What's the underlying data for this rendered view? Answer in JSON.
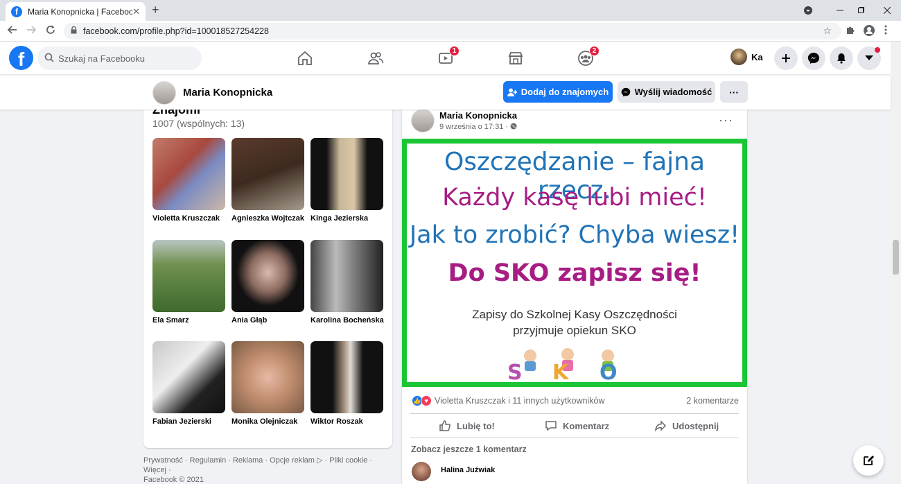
{
  "browser": {
    "tab_title": "Maria Konopnicka | Facebook",
    "tab_close": "✕",
    "new_tab": "+",
    "url": "facebook.com/profile.php?id=100018527254228"
  },
  "fb": {
    "logo": "f",
    "search_placeholder": "Szukaj na Facebooku",
    "watch_badge": "1",
    "groups_badge": "2",
    "profile_short": "Ka"
  },
  "profile": {
    "name": "Maria Konopnicka",
    "add_friend": "Dodaj do znajomych",
    "send_message": "Wyślij wiadomość",
    "more": "···"
  },
  "friends": {
    "title": "Znajomi",
    "count": "1007 (wspólnych: 13)",
    "items": [
      {
        "name": "Violetta Kruszczak"
      },
      {
        "name": "Agnieszka Wojtczak"
      },
      {
        "name": "Kinga Jezierska"
      },
      {
        "name": "Ela Smarz"
      },
      {
        "name": "Ania Głąb"
      },
      {
        "name": "Karolina Bocheńska"
      },
      {
        "name": "Fabian Jezierski"
      },
      {
        "name": "Monika Olejniczak"
      },
      {
        "name": "Wiktor Roszak"
      }
    ]
  },
  "footer": {
    "links": "Prywatność · Regulamin · Reklama · Opcje reklam ▷ · Pliki cookie · Więcej ·",
    "copyright": "Facebook © 2021"
  },
  "post": {
    "author": "Maria Konopnicka",
    "date": "9 września o 17:31 · ",
    "dots": "···",
    "image": {
      "line1": "Oszczędzanie – fajna rzecz.",
      "line2": "Każdy kasę lubi mieć!",
      "line3": "Jak to zrobić? Chyba wiesz!",
      "line4": "Do SKO zapisz się!",
      "line5": "Zapisy do Szkolnej Kasy Oszczędności przyjmuje opiekun SKO",
      "logo_text": "SKO"
    },
    "reactions": "Violetta Kruszczak i 11 innych użytkowników",
    "comments_count": "2 komentarze",
    "like": "Lubię to!",
    "comment": "Komentarz",
    "share": "Udostępnij",
    "more_comments": "Zobacz jeszcze 1 komentarz",
    "commenter": "Halina Juźwiak"
  }
}
